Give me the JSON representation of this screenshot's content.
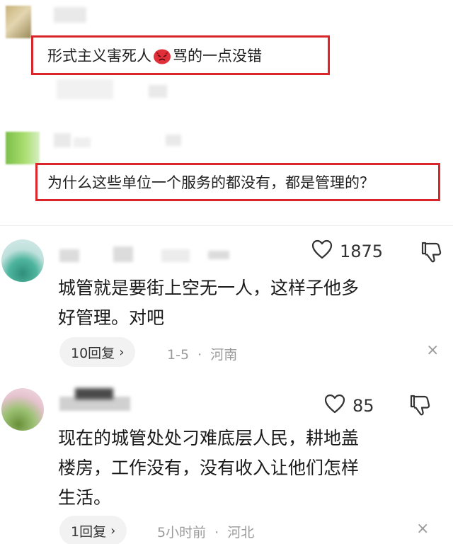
{
  "quotes": [
    {
      "text_before": "形式主义害死人",
      "emoji": "angry-face",
      "text_after": "骂的一点没错"
    },
    {
      "text": "为什么这些单位一个服务的都没有，都是管理的？"
    }
  ],
  "comments": [
    {
      "likes": "1875",
      "text_line1": "城管就是要街上空无一人，这样子他多",
      "text_line2": "好管理。对吧",
      "reply_label": "10回复",
      "reply_chevron": "›",
      "time": "1-5",
      "sep": "·",
      "location": "河南",
      "close": "×"
    },
    {
      "likes": "85",
      "text_line1": "现在的城管处处刁难底层人民，耕地盖",
      "text_line2": "楼房，工作没有，没有收入让他们怎样",
      "text_line3": "生活。",
      "reply_label": "1回复",
      "reply_chevron": "›",
      "time": "5小时前",
      "sep": "·",
      "location": "河北",
      "close": "×"
    }
  ],
  "colors": {
    "highlight_border": "#d8262b",
    "meta_text": "#9a9a9a",
    "pill_bg": "#f2f2f2"
  }
}
